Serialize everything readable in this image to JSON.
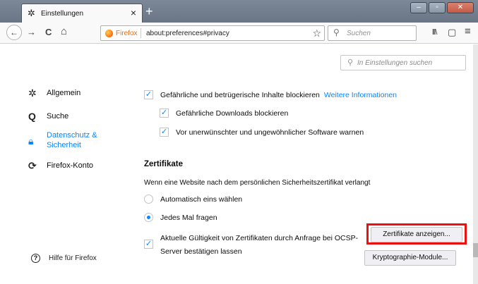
{
  "tab": {
    "title": "Einstellungen",
    "icon": "gear-icon",
    "close": "×",
    "new": "+"
  },
  "window": {
    "minimize": "–",
    "maximize": "▫",
    "close": "✕"
  },
  "navbar": {
    "back": "←",
    "forward": "→",
    "reload": "C",
    "home": "⌂",
    "identity": "Firefox",
    "url": "about:preferences#privacy",
    "bookmark": "☆",
    "search_placeholder": "Suchen",
    "library": "lll\\",
    "sidebar": "▢",
    "menu": "≡"
  },
  "pref_search_placeholder": "In Einstellungen suchen",
  "sidebar": {
    "items": [
      {
        "label": "Allgemein",
        "icon": "gear-icon"
      },
      {
        "label": "Suche",
        "icon": "search-icon"
      },
      {
        "label": "Datenschutz &",
        "label2": "Sicherheit",
        "icon": "lock-icon"
      },
      {
        "label": "Firefox-Konto",
        "icon": "sync-icon"
      }
    ],
    "help": "Hilfe für Firefox"
  },
  "content": {
    "block_dangerous": "Gefährliche und betrügerische Inhalte blockieren",
    "more_info": "Weitere Informationen",
    "block_downloads": "Gefährliche Downloads blockieren",
    "warn_software": "Vor unerwünschter und ungewöhnlicher Software warnen",
    "cert_heading": "Zertifikate",
    "cert_desc": "Wenn eine Website nach dem persönlichen Sicherheitszertifikat verlangt",
    "auto_select": "Automatisch eins wählen",
    "ask_every_time": "Jedes Mal fragen",
    "ocsp_line1": "Aktuelle Gültigkeit von Zertifikaten durch Anfrage bei OCSP-",
    "ocsp_line2": "Server bestätigen lassen",
    "show_certs_button": "Zertifikate anzeigen...",
    "crypto_button": "Kryptographie-Module..."
  },
  "colors": {
    "accent": "#0a84ff",
    "highlight": "#ec1010"
  }
}
